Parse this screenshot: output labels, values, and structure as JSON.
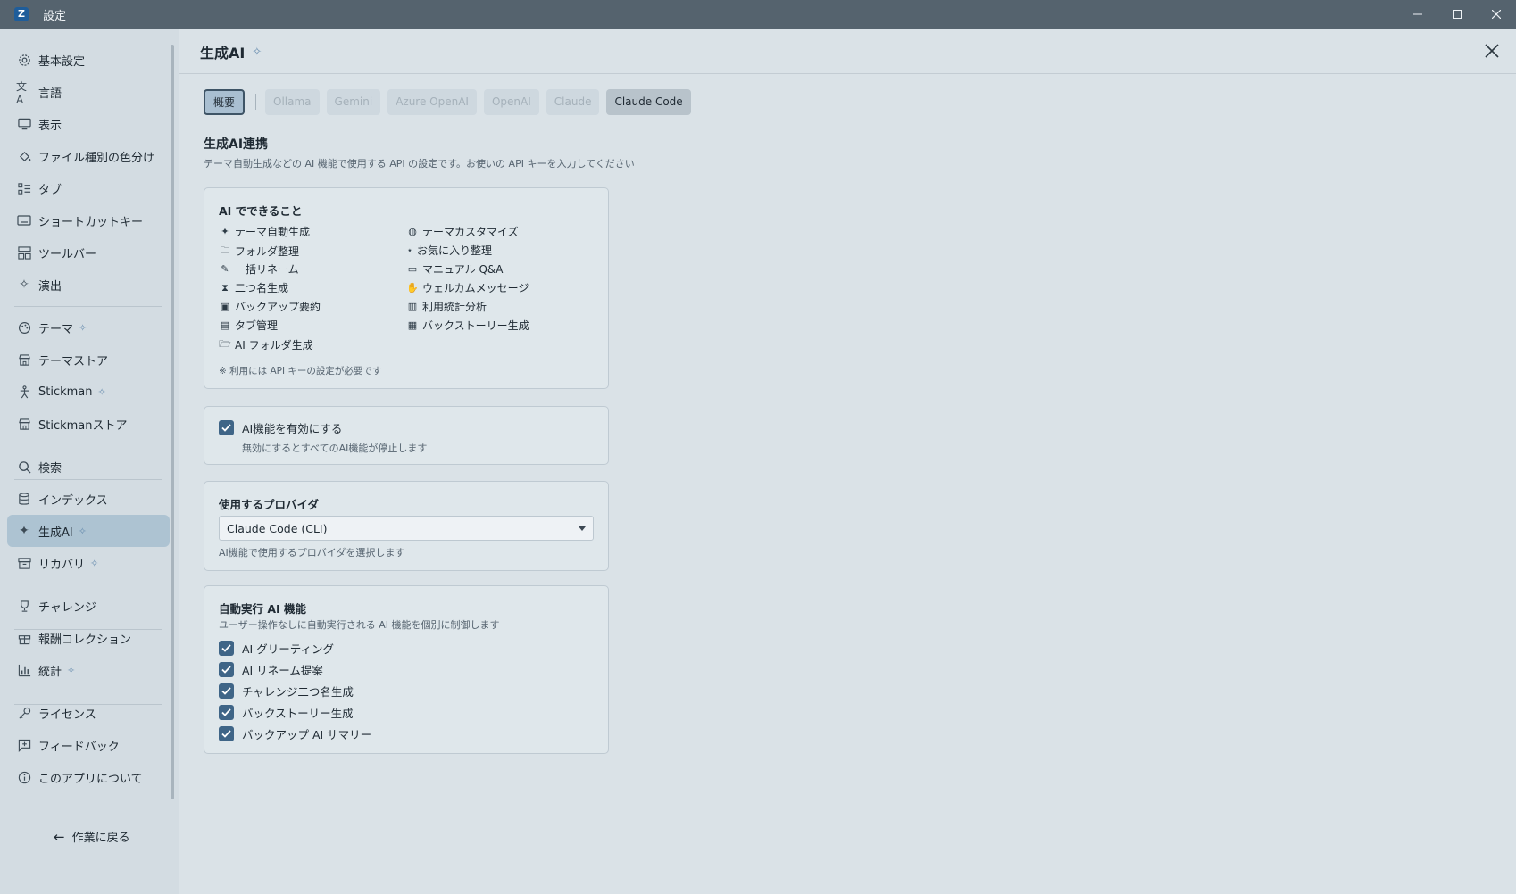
{
  "window": {
    "title": "設定",
    "logo_letter": "Z"
  },
  "sidebar": {
    "items": [
      {
        "label": "基本設定"
      },
      {
        "label": "言語"
      },
      {
        "label": "表示"
      },
      {
        "label": "ファイル種別の色分け"
      },
      {
        "label": "タブ"
      },
      {
        "label": "ショートカットキー"
      },
      {
        "label": "ツールバー"
      },
      {
        "label": "演出"
      },
      {
        "label": "テーマ"
      },
      {
        "label": "テーマストア"
      },
      {
        "label": "Stickman"
      },
      {
        "label": "Stickmanストア"
      },
      {
        "label": "検索"
      },
      {
        "label": "インデックス"
      },
      {
        "label": "生成AI"
      },
      {
        "label": "リカバリ"
      },
      {
        "label": "チャレンジ"
      },
      {
        "label": "報酬コレクション"
      },
      {
        "label": "統計"
      },
      {
        "label": "ライセンス"
      },
      {
        "label": "フィードバック"
      },
      {
        "label": "このアプリについて"
      }
    ],
    "back_label": "作業に戻る"
  },
  "page": {
    "title": "生成AI",
    "tabs": [
      {
        "label": "概要"
      },
      {
        "label": "Ollama"
      },
      {
        "label": "Gemini"
      },
      {
        "label": "Azure OpenAI"
      },
      {
        "label": "OpenAI"
      },
      {
        "label": "Claude"
      },
      {
        "label": "Claude Code"
      }
    ],
    "section_title": "生成AI連携",
    "section_desc": "テーマ自動生成などの AI 機能で使用する API の設定です。お使いの API キーを入力してください",
    "features_card": {
      "heading": "AI でできること",
      "left": [
        "テーマ自動生成",
        "フォルダ整理",
        "一括リネーム",
        "二つ名生成",
        "バックアップ要約",
        "タブ管理",
        "AI フォルダ生成"
      ],
      "right": [
        "テーマカスタマイズ",
        "お気に入り整理",
        "マニュアル Q&A",
        "ウェルカムメッセージ",
        "利用統計分析",
        "バックストーリー生成"
      ],
      "note": "※ 利用には API キーの設定が必要です"
    },
    "enable_card": {
      "label": "AI機能を有効にする",
      "desc": "無効にするとすべてのAI機能が停止します",
      "checked": true
    },
    "provider_card": {
      "heading": "使用するプロバイダ",
      "selected": "Claude Code (CLI)",
      "desc": "AI機能で使用するプロバイダを選択します"
    },
    "auto_card": {
      "heading": "自動実行 AI 機能",
      "desc": "ユーザー操作なしに自動実行される AI 機能を個別に制御します",
      "items": [
        {
          "label": "AI グリーティング",
          "checked": true
        },
        {
          "label": "AI リネーム提案",
          "checked": true
        },
        {
          "label": "チャレンジ二つ名生成",
          "checked": true
        },
        {
          "label": "バックストーリー生成",
          "checked": true
        },
        {
          "label": "バックアップ AI サマリー",
          "checked": true
        }
      ]
    }
  },
  "colors": {
    "accent": "#3f6587",
    "active_nav": "#adc3d2",
    "titlebar": "#55636e"
  }
}
